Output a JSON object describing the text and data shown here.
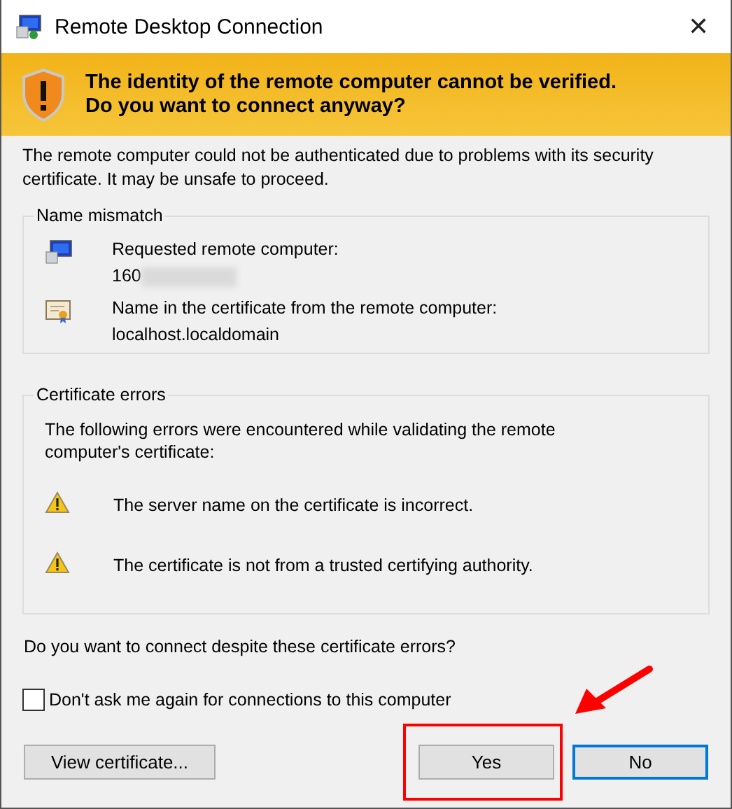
{
  "window": {
    "title": "Remote Desktop Connection",
    "close": "✕"
  },
  "banner": {
    "message": "The identity of the remote computer cannot be verified. Do you want to connect anyway?"
  },
  "intro": "The remote computer could not be authenticated due to problems with its security certificate. It may be unsafe to proceed.",
  "name_mismatch": {
    "title": "Name mismatch",
    "items": [
      {
        "kind": "computer",
        "label": "Requested remote computer:",
        "value": "160",
        "redacted": true
      },
      {
        "kind": "certificate",
        "label": "Name in the certificate from the remote computer:",
        "value": "localhost.localdomain",
        "redacted": false
      }
    ]
  },
  "certificate_errors": {
    "title": "Certificate errors",
    "description": "The following errors were encountered while validating the remote computer's certificate:",
    "errors": [
      "The server name on the certificate is incorrect.",
      "The certificate is not from a trusted certifying authority."
    ]
  },
  "question": "Do you want to connect despite these certificate errors?",
  "dont_ask": {
    "label": "Don't ask me again for connections to this computer",
    "checked": false
  },
  "buttons": [
    {
      "kind": "left",
      "label": "View certificate...",
      "default": false
    },
    {
      "kind": "right",
      "label": "Yes",
      "default": false
    },
    {
      "kind": "right",
      "label": "No",
      "default": true
    }
  ],
  "annotations": {
    "highlight_box": true,
    "arrow": true
  }
}
